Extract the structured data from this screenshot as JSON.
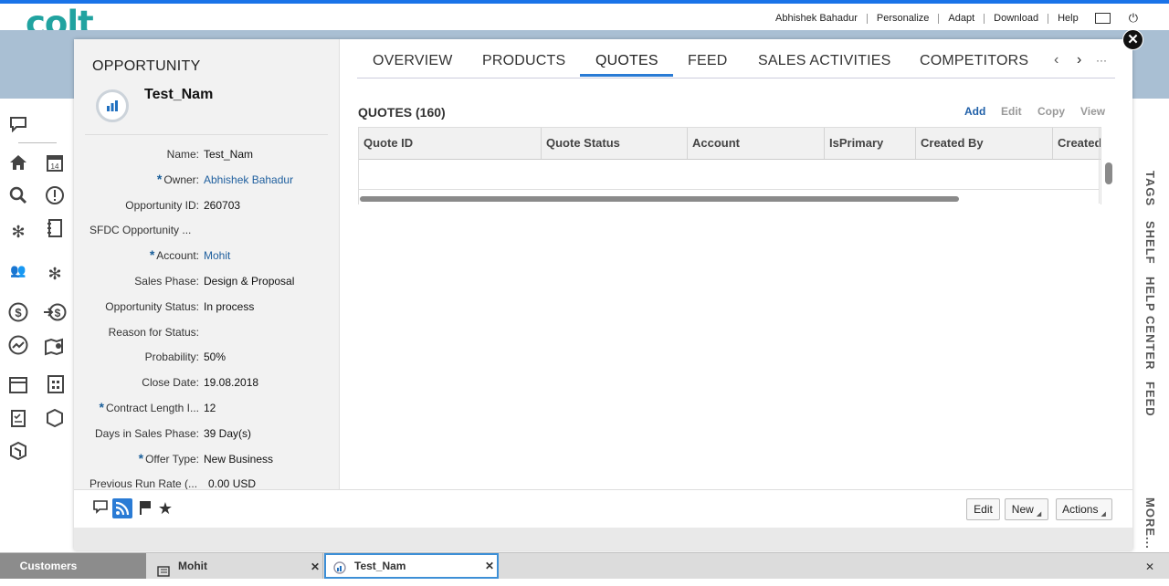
{
  "header": {
    "logo": "colt",
    "links": [
      "Abhishek Bahadur",
      "Personalize",
      "Adapt",
      "Download",
      "Help"
    ]
  },
  "right_rail": [
    "TAGS",
    "SHELF",
    "HELP CENTER",
    "FEED",
    "MORE..."
  ],
  "left_rail_icons": [
    "chat-icon",
    "home-icon",
    "calendar-icon",
    "search-icon",
    "alert-icon",
    "gear-icon",
    "notebook-icon",
    "contacts-icon",
    "settings-icon",
    "dollar-icon",
    "transfer-dollar-icon",
    "growth-icon",
    "map-icon",
    "calendar-grid-icon",
    "calculator-icon",
    "checklist-icon",
    "box-icon",
    "package-icon"
  ],
  "opportunity": {
    "title": "OPPORTUNITY",
    "name": "Test_Nam",
    "fields": [
      {
        "label": "Name:",
        "value": "Test_Nam",
        "link": false,
        "required": false
      },
      {
        "label": "Owner:",
        "value": "Abhishek Bahadur",
        "link": true,
        "required": true
      },
      {
        "label": "Opportunity ID:",
        "value": "260703",
        "link": false,
        "required": false
      },
      {
        "label": "SFDC Opportunity ...",
        "value": "",
        "link": false,
        "required": false
      },
      {
        "label": "Account:",
        "value": "Mohit",
        "link": true,
        "required": true
      },
      {
        "label": "Sales Phase:",
        "value": "Design & Proposal",
        "link": false,
        "required": false
      },
      {
        "label": "Opportunity Status:",
        "value": "In process",
        "link": false,
        "required": false
      },
      {
        "label": "Reason for Status:",
        "value": "",
        "link": false,
        "required": false
      },
      {
        "label": "Probability:",
        "value": "50%",
        "link": false,
        "required": false
      },
      {
        "label": "Close Date:",
        "value": "19.08.2018",
        "link": false,
        "required": false
      },
      {
        "label": "Contract Length I...",
        "value": "12",
        "link": false,
        "required": true
      },
      {
        "label": "Days in Sales Phase:",
        "value": "39 Day(s)",
        "link": false,
        "required": false
      },
      {
        "label": "Offer Type:",
        "value": "New Business",
        "link": false,
        "required": true
      },
      {
        "label": "Previous Run Rate (...",
        "value": "0.00 USD",
        "link": false,
        "required": false
      }
    ]
  },
  "tabs": [
    "OVERVIEW",
    "PRODUCTS",
    "QUOTES",
    "FEED",
    "SALES ACTIVITIES",
    "COMPETITORS"
  ],
  "active_tab": "QUOTES",
  "quotes": {
    "title": "QUOTES (160)",
    "actions": [
      "Add",
      "Edit",
      "Copy",
      "View"
    ],
    "columns": [
      "Quote ID",
      "Quote Status",
      "Account",
      "IsPrimary",
      "Created By",
      "Created"
    ]
  },
  "footer_buttons": {
    "edit": "Edit",
    "new": "New",
    "actions": "Actions"
  },
  "taskbar": {
    "customers": "Customers",
    "item1": "Mohit",
    "item2": "Test_Nam"
  },
  "colors": {
    "accent": "#2a7bd5",
    "brand": "#21a3a0",
    "link": "#1f5f9e"
  }
}
